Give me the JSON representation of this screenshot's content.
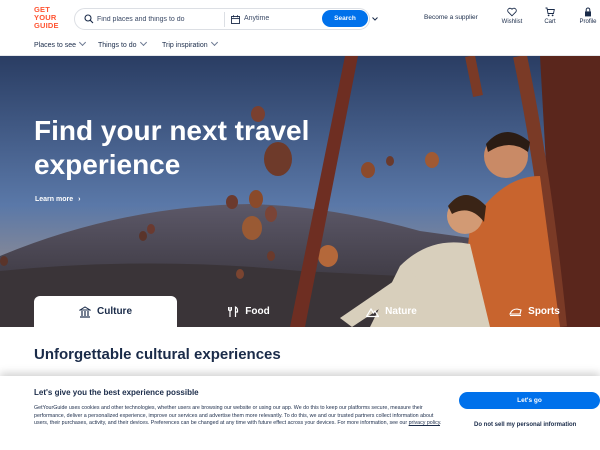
{
  "header": {
    "logo_lines": [
      "GET",
      "YOUR",
      "GUIDE"
    ],
    "search_placeholder": "Find places and things to do",
    "date_label": "Anytime",
    "search_button": "Search",
    "supplier_link": "Become a supplier",
    "icons": [
      {
        "name": "wishlist",
        "icon": "heart-icon",
        "label": "Wishlist"
      },
      {
        "name": "cart",
        "icon": "cart-icon",
        "label": "Cart"
      },
      {
        "name": "profile",
        "icon": "lock-icon",
        "label": "Profile"
      }
    ]
  },
  "nav": {
    "items": [
      "Places to see",
      "Things to do",
      "Trip inspiration"
    ]
  },
  "hero": {
    "title": "Find your next travel experience",
    "learn_more": "Learn more"
  },
  "tabs": [
    {
      "label": "Culture",
      "icon": "museum-icon",
      "active": true
    },
    {
      "label": "Food",
      "icon": "cutlery-icon",
      "active": false
    },
    {
      "label": "Nature",
      "icon": "mountain-icon",
      "active": false
    },
    {
      "label": "Sports",
      "icon": "sports-icon",
      "active": false
    }
  ],
  "section": {
    "title": "Unforgettable cultural experiences"
  },
  "cookie": {
    "title": "Let's give you the best experience possible",
    "body": "GetYourGuide uses cookies and other technologies, whether users are browsing our website or using our app. We do this to keep our platforms secure, measure their performance, deliver a personalized experience, improve our services and advertise them more relevantly. To do this, we and our trusted partners collect information about users, their purchases, activity, and their devices. Preferences can be changed at any time with future effect across your devices. For more information, see our",
    "policy_link": "privacy policy",
    "accept_button": "Let's go",
    "no_sell": "Do not sell my personal information"
  },
  "colors": {
    "brand": "#ff5533",
    "primary": "#0071eb",
    "text": "#1a2b49"
  }
}
